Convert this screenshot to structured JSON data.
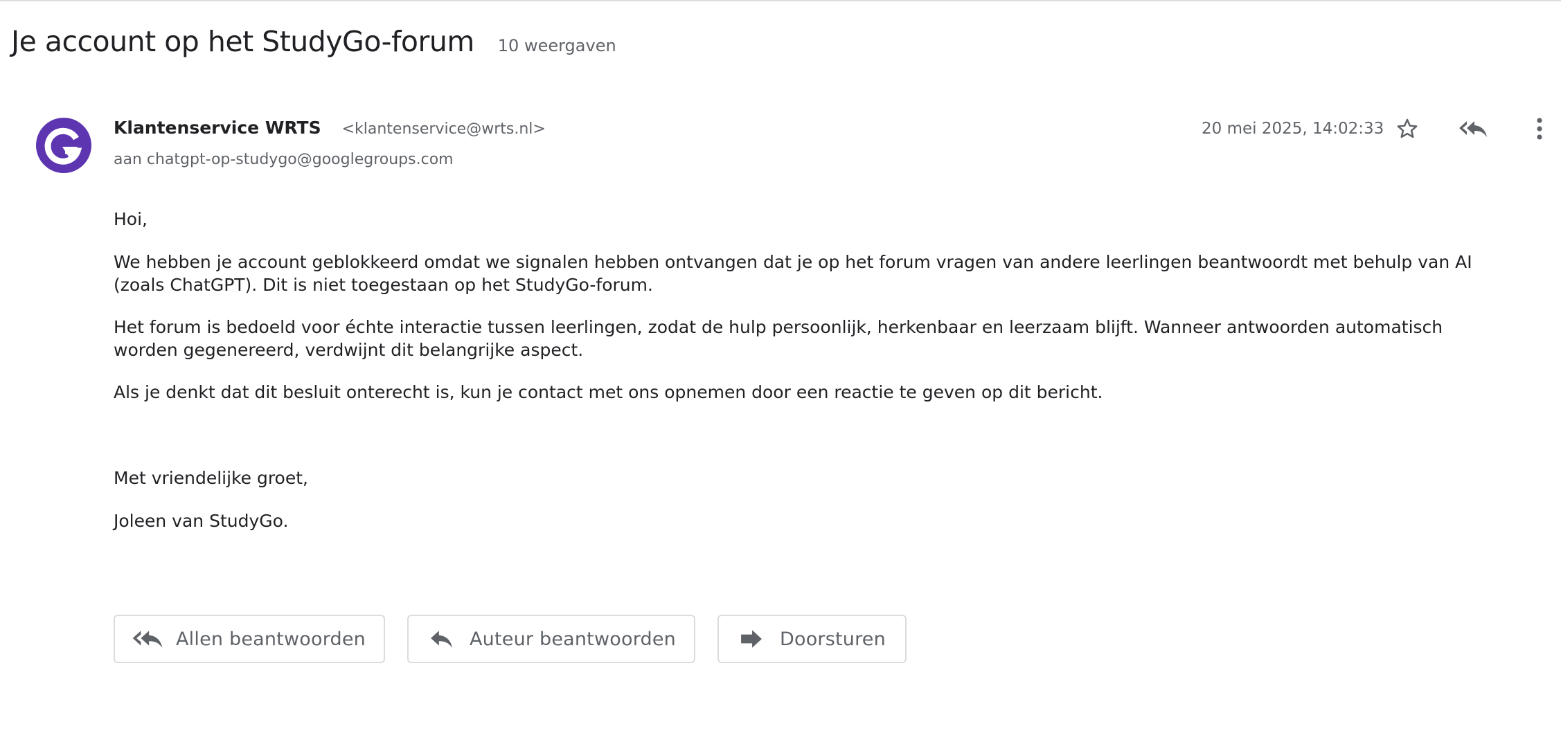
{
  "thread": {
    "subject": "Je account op het StudyGo-forum",
    "views": "10 weergaven"
  },
  "message": {
    "avatar_letter": "G",
    "avatar_color": "#5e35b1",
    "sender_name": "Klantenservice WRTS",
    "sender_email": "<klantenservice@wrts.nl>",
    "to": "aan chatgpt-op-studygo@googlegroups.com",
    "date": "20 mei 2025, 14:02:33",
    "icons": {
      "star": "star-icon",
      "reply_all": "reply-all-icon",
      "more": "more-vert-icon"
    },
    "body": {
      "greeting": "Hoi,",
      "paragraphs": [
        "We hebben je account geblokkeerd omdat we signalen hebben ontvangen dat je op het forum vragen van andere leerlingen beantwoordt met behulp van AI (zoals ChatGPT). Dit is niet toegestaan op het StudyGo-forum.",
        "Het forum is bedoeld voor échte interactie tussen leerlingen, zodat de hulp persoonlijk, herkenbaar en leerzaam blijft. Wanneer antwoorden automatisch worden gegenereerd, verdwijnt dit belangrijke aspect.",
        "Als je denkt dat dit besluit onterecht is, kun je contact met ons opnemen door een reactie te geven op dit bericht."
      ],
      "closing": "Met vriendelijke groet,",
      "signature": "Joleen van StudyGo."
    }
  },
  "actions": {
    "reply_all": "Allen beantwoorden",
    "reply": "Auteur beantwoorden",
    "forward": "Doorsturen"
  },
  "colors": {
    "text": "#202124",
    "muted": "#5f6368",
    "border": "#dadce0"
  }
}
